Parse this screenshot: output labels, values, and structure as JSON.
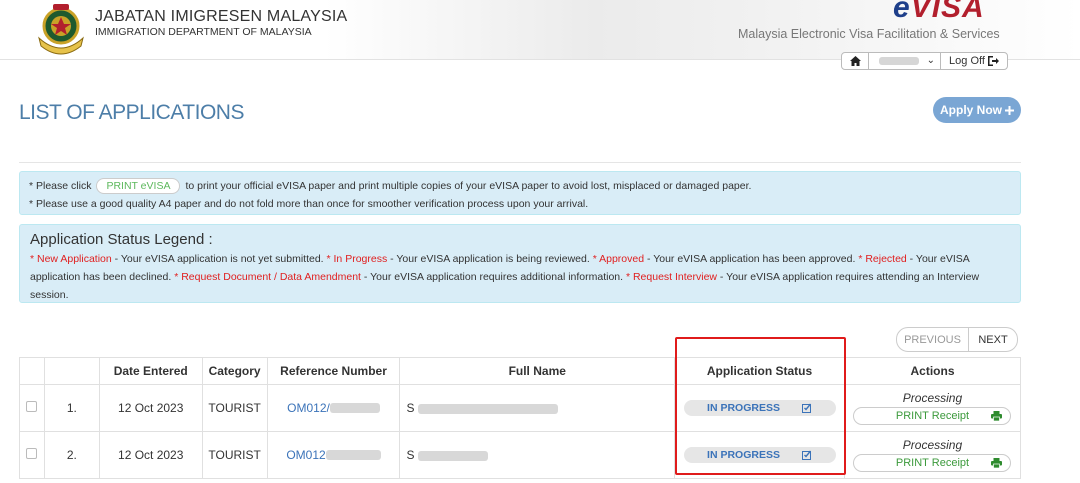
{
  "header": {
    "agency_name": "JABATAN IMIGRESEN MALAYSIA",
    "agency_name_en": "IMMIGRATION DEPARTMENT OF MALAYSIA",
    "crest_text": "IMIGRESEN MALAYSIA",
    "logo_prefix": "e",
    "logo_text": "VISA",
    "tagline": "Malaysia Electronic Visa Facilitation & Services",
    "logoff_label": "Log Off"
  },
  "page": {
    "title": "LIST OF APPLICATIONS",
    "apply_label": "Apply Now"
  },
  "info": {
    "line1_before": "*  Please click",
    "print_evisa": "PRINT eVISA",
    "line1_after": "to print your official eVISA paper and print multiple copies of your eVISA paper to avoid lost, misplaced or damaged paper.",
    "line2": "*  Please use a good quality A4 paper and do not fold more than once for smoother verification process upon your arrival."
  },
  "legend": {
    "title": "Application Status Legend :",
    "items": [
      {
        "term": "* New Application",
        "desc": " - Your eVISA application is not yet submitted. "
      },
      {
        "term": "* In Progress",
        "desc": " - Your eVISA application is being reviewed. "
      },
      {
        "term": "* Approved",
        "desc": " - Your eVISA application has been approved. "
      },
      {
        "term": "* Rejected",
        "desc": " - Your eVISA application has been declined. "
      },
      {
        "term": "* Request Document / Data Amendment",
        "desc": " - Your eVISA application requires additional information. "
      },
      {
        "term": "* Request Interview",
        "desc": "  - Your eVISA application requires attending an Interview session."
      }
    ]
  },
  "pager": {
    "previous": "PREVIOUS",
    "next": "NEXT"
  },
  "table": {
    "headers": [
      "Date Entered",
      "Category",
      "Reference Number",
      "Full Name",
      "Application Status",
      "Actions"
    ],
    "rows": [
      {
        "index": "1.",
        "date": "12 Oct 2023",
        "category": "TOURIST",
        "ref_prefix": "OM012/",
        "name_prefix": "S",
        "status": "IN PROGRESS",
        "action_status": "Processing",
        "receipt_label": "PRINT Receipt"
      },
      {
        "index": "2.",
        "date": "12 Oct 2023",
        "category": "TOURIST",
        "ref_prefix": "OM012",
        "name_prefix": "S",
        "status": "IN PROGRESS",
        "action_status": "Processing",
        "receipt_label": "PRINT Receipt"
      }
    ]
  },
  "colors": {
    "title_blue": "#4d7ea8",
    "info_bg": "#d9edf7",
    "legend_red": "#e02020",
    "link_blue": "#3b73b9",
    "receipt_green": "#3c9a3c",
    "highlight_red": "#e01b1b"
  },
  "icons": [
    "crest-icon",
    "home-icon",
    "chevron-down-icon",
    "logout-icon",
    "plus-icon",
    "edit-icon",
    "printer-icon"
  ]
}
